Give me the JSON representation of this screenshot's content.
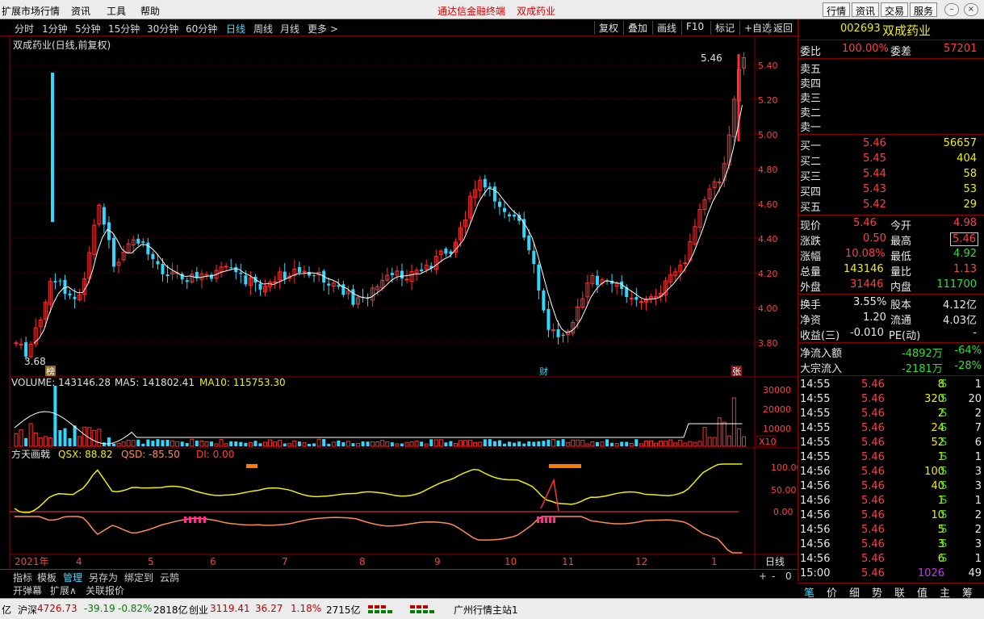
{
  "menubar": {
    "items": [
      "扩展市场行情",
      "资讯",
      "工具",
      "帮助"
    ],
    "center_title": "通达信金融终端",
    "center_stock": "双成药业",
    "right_buttons": [
      "行情",
      "资讯",
      "交易",
      "服务"
    ]
  },
  "periodbar": {
    "periods": [
      "分时",
      "1分钟",
      "5分钟",
      "15分钟",
      "30分钟",
      "60分钟",
      "日线",
      "周线",
      "月线",
      "更多 >"
    ],
    "active": "日线",
    "tools": [
      "复权",
      "叠加",
      "画线",
      "F10",
      "标记",
      "+自选",
      "返回"
    ]
  },
  "chart": {
    "title": "双成药业(日线,前复权)",
    "high_label": "5.46",
    "low_label": "3.68",
    "price_ticks": [
      "5.40",
      "5.20",
      "5.00",
      "4.80",
      "4.60",
      "4.40",
      "4.20",
      "4.00",
      "3.80"
    ],
    "markers": {
      "bang": "榜",
      "cai": "财",
      "zhang": "张"
    },
    "volume": {
      "label": "VOLUME: 143146.28",
      "ma5": "MA5: 141802.41",
      "ma10": "MA10: 115753.30",
      "ticks": [
        "30000",
        "20000",
        "10000"
      ],
      "unit": "X10"
    },
    "indicator": {
      "name": "方天画戟",
      "qsx": "QSX: 88.82",
      "qsd": "QSD: -85.50",
      "di": "DI: 0.00",
      "ticks": [
        "100.00",
        "50.00",
        "0.00"
      ]
    },
    "time_axis": [
      "2021年",
      "4",
      "5",
      "6",
      "7",
      "8",
      "9",
      "10",
      "11",
      "12",
      "1"
    ],
    "period_tag": "日线",
    "zoom_controls": [
      "+",
      "-",
      "0"
    ],
    "colors": {
      "up": "#ff3030",
      "down": "#30d8ff",
      "ma": "#ffffff",
      "qsx": "#f0f000",
      "qsd": "#ff8c50"
    }
  },
  "chart_data": {
    "type": "candlestick",
    "note_price_range": [
      3.68,
      5.46
    ],
    "ylim": [
      3.7,
      5.5
    ]
  },
  "quote": {
    "code": "002693",
    "name": "双成药业",
    "webi_label": "委比",
    "webi": "100.00%",
    "wecha_label": "委差",
    "wecha": "57201",
    "sells": [
      "卖五",
      "卖四",
      "卖三",
      "卖二",
      "卖一"
    ],
    "buys": [
      {
        "label": "买一",
        "price": "5.46",
        "vol": "56657"
      },
      {
        "label": "买二",
        "price": "5.45",
        "vol": "404"
      },
      {
        "label": "买三",
        "price": "5.44",
        "vol": "58"
      },
      {
        "label": "买四",
        "price": "5.43",
        "vol": "53"
      },
      {
        "label": "买五",
        "price": "5.42",
        "vol": "29"
      }
    ],
    "stats": [
      {
        "l1": "现价",
        "v1": "5.46",
        "c1": "red",
        "l2": "今开",
        "v2": "4.98",
        "c2": "red"
      },
      {
        "l1": "涨跌",
        "v1": "0.50",
        "c1": "red",
        "l2": "最高",
        "v2": "5.46",
        "c2": "red"
      },
      {
        "l1": "涨幅",
        "v1": "10.08%",
        "c1": "red",
        "l2": "最低",
        "v2": "4.92",
        "c2": "green"
      },
      {
        "l1": "总量",
        "v1": "143146",
        "c1": "yellow",
        "l2": "量比",
        "v2": "1.13",
        "c2": "red"
      },
      {
        "l1": "外盘",
        "v1": "31446",
        "c1": "red",
        "l2": "内盘",
        "v2": "111700",
        "c2": "green"
      }
    ],
    "stats2": [
      {
        "l1": "换手",
        "v1": "3.55%",
        "l2": "股本",
        "v2": "4.12亿"
      },
      {
        "l1": "净资",
        "v1": "1.20",
        "l2": "流通",
        "v2": "4.03亿"
      },
      {
        "l1": "收益(三)",
        "v1": "-0.010",
        "l2": "PE(动)",
        "v2": "-"
      }
    ],
    "flow": [
      {
        "label": "净流入额",
        "v": "-4892万",
        "p": "-64%"
      },
      {
        "label": "大宗流入",
        "v": "-2181万",
        "p": "-28%"
      }
    ],
    "ticks": [
      {
        "t": "14:55",
        "p": "5.46",
        "v": "8",
        "vc": "yellow",
        "s": "S",
        "n": "1"
      },
      {
        "t": "14:55",
        "p": "5.46",
        "v": "320",
        "vc": "yellow",
        "s": "S",
        "n": "20"
      },
      {
        "t": "14:55",
        "p": "5.46",
        "v": "2",
        "vc": "yellow",
        "s": "S",
        "n": "2"
      },
      {
        "t": "14:55",
        "p": "5.46",
        "v": "24",
        "vc": "yellow",
        "s": "S",
        "n": "7"
      },
      {
        "t": "14:55",
        "p": "5.46",
        "v": "52",
        "vc": "yellow",
        "s": "S",
        "n": "6"
      },
      {
        "t": "14:55",
        "p": "5.46",
        "v": "1",
        "vc": "yellow",
        "s": "S",
        "n": "1"
      },
      {
        "t": "14:56",
        "p": "5.46",
        "v": "100",
        "vc": "yellow",
        "s": "S",
        "n": "3"
      },
      {
        "t": "14:56",
        "p": "5.46",
        "v": "40",
        "vc": "yellow",
        "s": "S",
        "n": "3"
      },
      {
        "t": "14:56",
        "p": "5.46",
        "v": "1",
        "vc": "yellow",
        "s": "S",
        "n": "1"
      },
      {
        "t": "14:56",
        "p": "5.46",
        "v": "10",
        "vc": "yellow",
        "s": "S",
        "n": "2"
      },
      {
        "t": "14:56",
        "p": "5.46",
        "v": "5",
        "vc": "yellow",
        "s": "S",
        "n": "2"
      },
      {
        "t": "14:56",
        "p": "5.46",
        "v": "3",
        "vc": "yellow",
        "s": "S",
        "n": "3"
      },
      {
        "t": "14:56",
        "p": "5.46",
        "v": "6",
        "vc": "yellow",
        "s": "S",
        "n": "1"
      },
      {
        "t": "15:00",
        "p": "5.46",
        "v": "1026",
        "vc": "purple",
        "s": "",
        "n": "49"
      }
    ],
    "tabs": [
      "笔",
      "价",
      "细",
      "势",
      "联",
      "值",
      "主",
      "筹"
    ]
  },
  "bottom_tabs1": [
    "指标",
    "模板",
    "管理",
    "另存为",
    "绑定到",
    "云鹄"
  ],
  "bottom_tabs2": [
    "开弹幕",
    "扩展∧",
    "关联报价"
  ],
  "status": {
    "tail": "亿",
    "hs_label": "沪深",
    "hs_val": "4726.73",
    "hs_chg": "-39.19",
    "hs_pct": "-0.82%",
    "hs_amt": "2818亿",
    "cy_label": "创业",
    "cy_val": "3119.41",
    "cy_chg": "36.27",
    "cy_pct": "1.18%",
    "cy_amt": "2715亿",
    "station": "广州行情主站1"
  }
}
